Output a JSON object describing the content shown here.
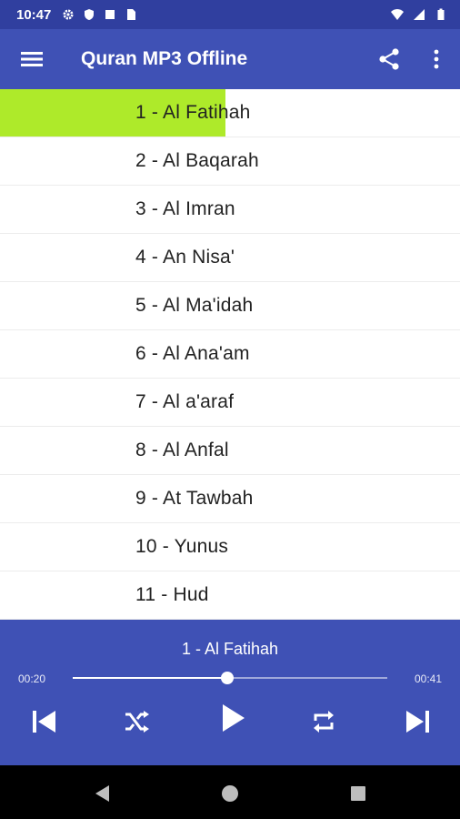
{
  "status_bar": {
    "time": "10:47",
    "icons_left": [
      "gear-icon",
      "shield-icon",
      "square-icon",
      "sim-card-icon"
    ],
    "icons_right": [
      "wifi-icon",
      "cellular-signal-icon",
      "battery-icon"
    ]
  },
  "app_bar": {
    "title": "Quran MP3 Offline",
    "menu_icon": "hamburger-menu-icon",
    "share_icon": "share-icon",
    "overflow_icon": "more-vert-icon",
    "background_color": "#3f51b5"
  },
  "surah_list": {
    "items": [
      "1 - Al Fatihah",
      "2 - Al Baqarah",
      "3 - Al Imran",
      "4 - An Nisa'",
      "5 - Al Ma'idah",
      "6 - Al Ana'am",
      "7 - Al a'araf",
      "8 - Al Anfal",
      "9 - At Tawbah",
      "10 - Yunus",
      "11 - Hud"
    ],
    "playing_index": 0,
    "playing_progress": 0.49,
    "highlight_color": "#aeea2a"
  },
  "player": {
    "now_playing": "1 - Al Fatihah",
    "current_time": "00:20",
    "total_time": "00:41",
    "progress": 0.49,
    "controls": [
      "skip-previous-icon",
      "shuffle-icon",
      "play-icon",
      "repeat-icon",
      "skip-next-icon"
    ]
  },
  "nav_bar": {
    "buttons": [
      "back-triangle-icon",
      "home-circle-icon",
      "recents-square-icon"
    ]
  }
}
